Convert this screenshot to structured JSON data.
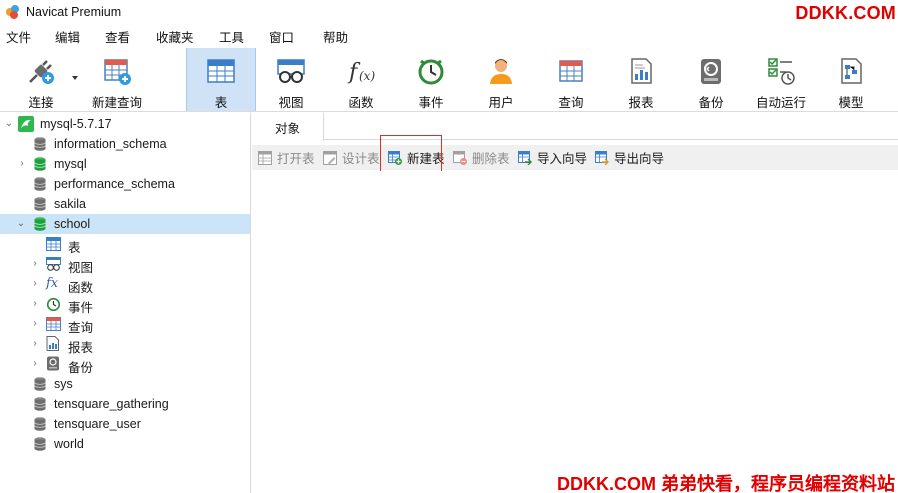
{
  "window": {
    "title": "Navicat Premium",
    "watermark_top": "DDKK.COM",
    "watermark_bottom": "DDKK.COM 弟弟快看，程序员编程资料站"
  },
  "menu": [
    "文件",
    "编辑",
    "查看",
    "收藏夹",
    "工具",
    "窗口",
    "帮助"
  ],
  "toolbar": [
    {
      "label": "连接",
      "icon": "connection-plug-icon"
    },
    {
      "label": "新建查询",
      "icon": "new-query-icon"
    },
    {
      "label": "表",
      "icon": "table-icon",
      "active": true
    },
    {
      "label": "视图",
      "icon": "view-icon"
    },
    {
      "label": "函数",
      "icon": "function-icon"
    },
    {
      "label": "事件",
      "icon": "event-clock-icon"
    },
    {
      "label": "用户",
      "icon": "user-icon"
    },
    {
      "label": "查询",
      "icon": "query-icon"
    },
    {
      "label": "报表",
      "icon": "report-icon"
    },
    {
      "label": "备份",
      "icon": "backup-icon"
    },
    {
      "label": "自动运行",
      "icon": "auto-run-icon"
    },
    {
      "label": "模型",
      "icon": "model-icon"
    }
  ],
  "tree": {
    "connection": "mysql-5.7.17",
    "databases": [
      {
        "name": "information_schema",
        "open": false,
        "expandable": false
      },
      {
        "name": "mysql",
        "open": true,
        "expandable": true
      },
      {
        "name": "performance_schema",
        "open": false,
        "expandable": false
      },
      {
        "name": "sakila",
        "open": false,
        "expandable": false
      },
      {
        "name": "school",
        "open": true,
        "expandable": true,
        "selected": true
      },
      {
        "name": "sys",
        "open": false,
        "expandable": false
      },
      {
        "name": "tensquare_gathering",
        "open": false,
        "expandable": false
      },
      {
        "name": "tensquare_user",
        "open": false,
        "expandable": false
      },
      {
        "name": "world",
        "open": false,
        "expandable": false
      }
    ],
    "school_children": [
      {
        "label": "表",
        "icon": "table-icon"
      },
      {
        "label": "视图",
        "icon": "view-icon"
      },
      {
        "label": "函数",
        "icon": "function-icon"
      },
      {
        "label": "事件",
        "icon": "event-clock-icon"
      },
      {
        "label": "查询",
        "icon": "query-icon"
      },
      {
        "label": "报表",
        "icon": "report-icon"
      },
      {
        "label": "备份",
        "icon": "backup-icon"
      }
    ]
  },
  "tabs": [
    "对象"
  ],
  "object_toolbar": [
    {
      "label": "打开表",
      "enabled": false
    },
    {
      "label": "设计表",
      "enabled": false
    },
    {
      "label": "新建表",
      "enabled": true,
      "highlighted": true
    },
    {
      "label": "删除表",
      "enabled": false
    },
    {
      "label": "导入向导",
      "enabled": true
    },
    {
      "label": "导出向导",
      "enabled": true
    }
  ],
  "colors": {
    "accent": "#cfe2f6",
    "selected_row": "#cce4f7",
    "highlight_border": "#d9302c",
    "db_green": "#1e9e3e",
    "watermark": "#e00000"
  }
}
